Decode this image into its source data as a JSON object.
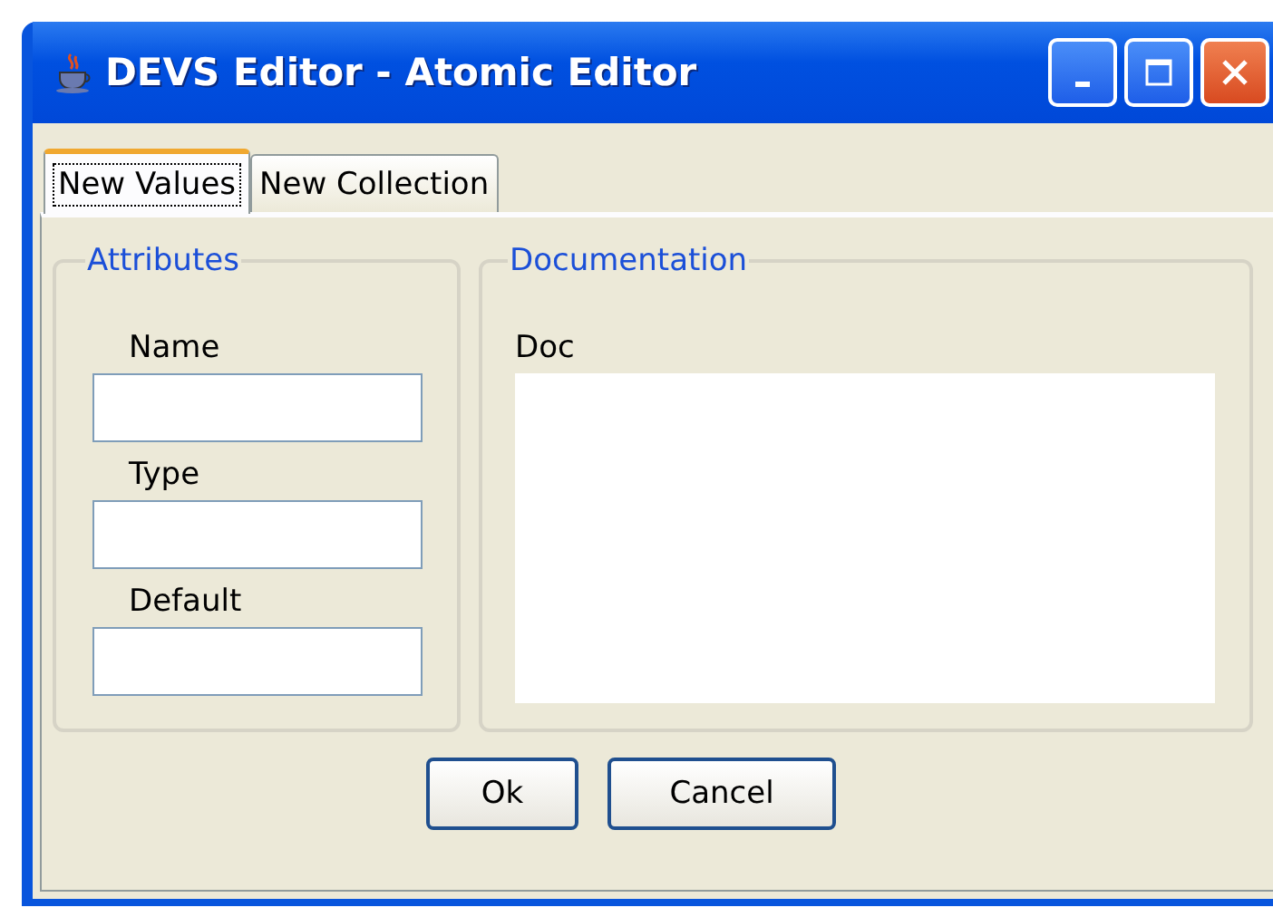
{
  "window": {
    "title": "DEVS Editor - Atomic Editor"
  },
  "tabs": [
    {
      "label": "New Values",
      "selected": true
    },
    {
      "label": "New Collection",
      "selected": false
    }
  ],
  "attributes": {
    "title": "Attributes",
    "fields": [
      {
        "label": "Name"
      },
      {
        "label": "Type"
      },
      {
        "label": "Default"
      }
    ]
  },
  "documentation": {
    "title": "Documentation",
    "label": "Doc"
  },
  "buttons": [
    "Ok",
    "Cancel"
  ]
}
